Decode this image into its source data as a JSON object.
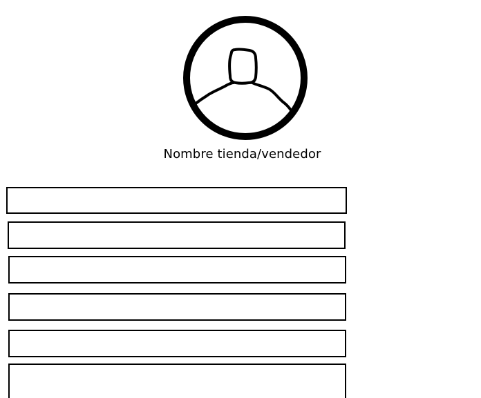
{
  "profile": {
    "avatar_icon": "user-avatar-icon",
    "store_name": "Nombre tienda/vendedor"
  },
  "form": {
    "fields": [
      {
        "value": ""
      },
      {
        "value": ""
      },
      {
        "value": ""
      },
      {
        "value": ""
      },
      {
        "value": ""
      },
      {
        "value": ""
      }
    ]
  }
}
